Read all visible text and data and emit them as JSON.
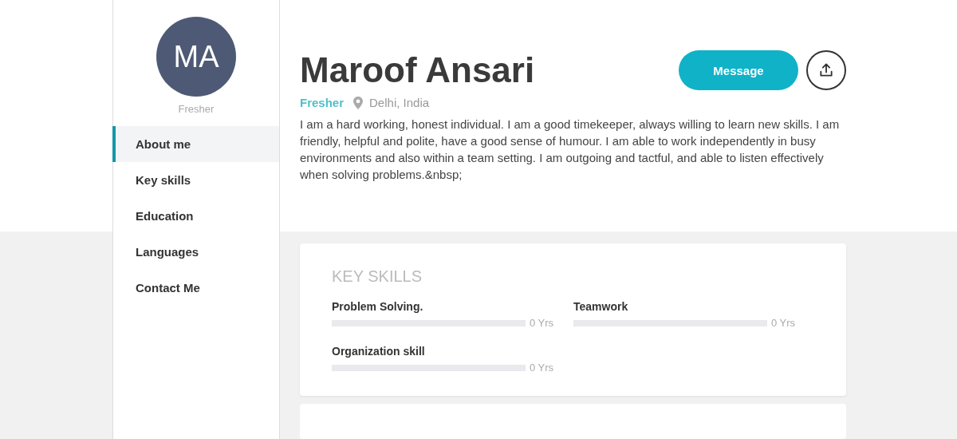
{
  "sidebar": {
    "avatar_initials": "MA",
    "status": "Fresher",
    "items": [
      {
        "label": "About me",
        "selected": true
      },
      {
        "label": "Key skills",
        "selected": false
      },
      {
        "label": "Education",
        "selected": false
      },
      {
        "label": "Languages",
        "selected": false
      },
      {
        "label": "Contact Me",
        "selected": false
      }
    ]
  },
  "profile": {
    "name": "Maroof Ansari",
    "status": "Fresher",
    "location": "Delhi, India",
    "about": "I am a hard working, honest individual. I am a good timekeeper, always willing to learn new skills. I am friendly, helpful and polite, have a good sense of humour. I am able to work independently in busy environments and also within a team setting. I am outgoing and tactful, and able to listen effectively when solving problems.&nbsp;",
    "message_button": "Message"
  },
  "key_skills": {
    "title": "KEY SKILLS",
    "skills": [
      {
        "name": "Problem Solving.",
        "level": 0,
        "reading": "0 Yrs"
      },
      {
        "name": "Teamwork",
        "level": 0,
        "reading": "0 Yrs"
      },
      {
        "name": "Organization skill",
        "level": 0,
        "reading": "0 Yrs"
      }
    ]
  }
}
